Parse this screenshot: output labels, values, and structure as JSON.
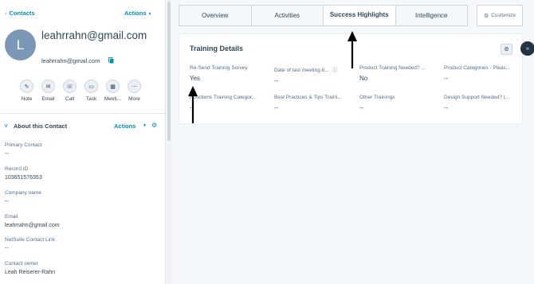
{
  "sidebar": {
    "back_label": "Contacts",
    "actions_label": "Actions",
    "contact": {
      "initial": "L",
      "name": "leahrrahn@gmail.com",
      "email": "leahrrahn@gmail.com"
    },
    "quick_actions": [
      {
        "label": "Note",
        "icon": "note-icon",
        "glyph": "✎"
      },
      {
        "label": "Email",
        "icon": "email-icon",
        "glyph": "✉"
      },
      {
        "label": "Call",
        "icon": "phone-icon",
        "glyph": "☏"
      },
      {
        "label": "Task",
        "icon": "task-icon",
        "glyph": "▭"
      },
      {
        "label": "Meeti...",
        "icon": "calendar-icon",
        "glyph": "▦"
      },
      {
        "label": "More",
        "icon": "more-icon",
        "glyph": "⋯"
      }
    ],
    "about": {
      "title": "About this Contact",
      "actions_label": "Actions",
      "properties": [
        {
          "label": "Primary Contact",
          "value": "--"
        },
        {
          "label": "Record ID",
          "value": "103651576353"
        },
        {
          "label": "Company name",
          "value": "--"
        },
        {
          "label": "Email",
          "value": "leahrrahn@gmail.com"
        },
        {
          "label": "NetSuite Contact Link",
          "value": "--"
        },
        {
          "label": "Contact owner",
          "value": "Leah Reiserer-Rahn"
        }
      ]
    }
  },
  "tabs": [
    {
      "label": "Overview",
      "active": false
    },
    {
      "label": "Activities",
      "active": false
    },
    {
      "label": "Success Highlights",
      "active": true
    },
    {
      "label": "Intelligence",
      "active": false
    }
  ],
  "customize_label": "Customize",
  "card": {
    "title": "Training Details",
    "fields": [
      {
        "label": "Re-Send Training Survey",
        "value": "Yes"
      },
      {
        "label": "Date of last meeting b...",
        "value": "--",
        "info": true
      },
      {
        "label": "Product Training Needed? ...",
        "value": "No"
      },
      {
        "label": "Product Categories - Pleas...",
        "value": "--"
      },
      {
        "label": "Functions Training Categor...",
        "value": "--"
      },
      {
        "label": "Best Practices & Tips Traini...",
        "value": "--"
      },
      {
        "label": "Other Trainings",
        "value": "--"
      },
      {
        "label": "Design Support Needed? (...",
        "value": "--"
      }
    ]
  },
  "colors": {
    "accent": "#0091ae",
    "text": "#33475b",
    "border": "#cbd6e2",
    "avatar": "#7c98b6"
  }
}
